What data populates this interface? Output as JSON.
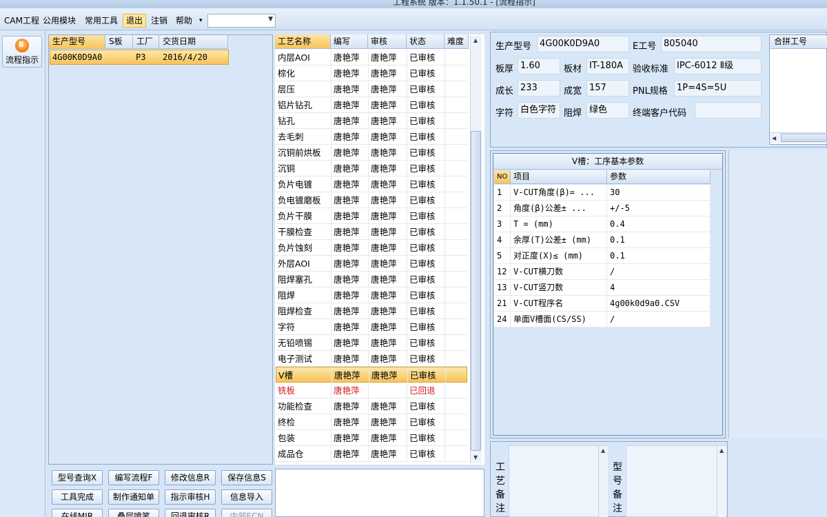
{
  "window": {
    "title": "工程系统   版本：1.1.50.1 - [流程指示]"
  },
  "menu": {
    "items": [
      "CAM工程",
      "公用模块",
      "常用工具",
      "退出",
      "注销",
      "帮助"
    ],
    "help_arrow": "▾",
    "combo_value": ""
  },
  "toolbar": {
    "flow_button": "流程指示"
  },
  "model_list": {
    "columns": [
      "生产型号",
      "S板",
      "工厂",
      "交货日期"
    ],
    "rows": [
      {
        "model": "4G00K0D9A0",
        "s": "",
        "factory": "P3",
        "date": "2016/4/20"
      }
    ]
  },
  "process_list": {
    "columns": [
      "工艺名称",
      "编写",
      "审核",
      "状态",
      "难度"
    ],
    "rows": [
      {
        "name": "内层AOI",
        "writer": "唐艳萍",
        "reviewer": "唐艳萍",
        "status": "已审核"
      },
      {
        "name": "棕化",
        "writer": "唐艳萍",
        "reviewer": "唐艳萍",
        "status": "已审核"
      },
      {
        "name": "层压",
        "writer": "唐艳萍",
        "reviewer": "唐艳萍",
        "status": "已审核"
      },
      {
        "name": "铝片钻孔",
        "writer": "唐艳萍",
        "reviewer": "唐艳萍",
        "status": "已审核"
      },
      {
        "name": "钻孔",
        "writer": "唐艳萍",
        "reviewer": "唐艳萍",
        "status": "已审核"
      },
      {
        "name": "去毛刺",
        "writer": "唐艳萍",
        "reviewer": "唐艳萍",
        "status": "已审核"
      },
      {
        "name": "沉铜前烘板",
        "writer": "唐艳萍",
        "reviewer": "唐艳萍",
        "status": "已审核"
      },
      {
        "name": "沉铜",
        "writer": "唐艳萍",
        "reviewer": "唐艳萍",
        "status": "已审核"
      },
      {
        "name": "负片电镀",
        "writer": "唐艳萍",
        "reviewer": "唐艳萍",
        "status": "已审核"
      },
      {
        "name": "负电镀磨板",
        "writer": "唐艳萍",
        "reviewer": "唐艳萍",
        "status": "已审核"
      },
      {
        "name": "负片干膜",
        "writer": "唐艳萍",
        "reviewer": "唐艳萍",
        "status": "已审核"
      },
      {
        "name": "干膜检查",
        "writer": "唐艳萍",
        "reviewer": "唐艳萍",
        "status": "已审核"
      },
      {
        "name": "负片蚀刻",
        "writer": "唐艳萍",
        "reviewer": "唐艳萍",
        "status": "已审核"
      },
      {
        "name": "外层AOI",
        "writer": "唐艳萍",
        "reviewer": "唐艳萍",
        "status": "已审核"
      },
      {
        "name": "阻焊塞孔",
        "writer": "唐艳萍",
        "reviewer": "唐艳萍",
        "status": "已审核"
      },
      {
        "name": "阻焊",
        "writer": "唐艳萍",
        "reviewer": "唐艳萍",
        "status": "已审核"
      },
      {
        "name": "阻焊检查",
        "writer": "唐艳萍",
        "reviewer": "唐艳萍",
        "status": "已审核"
      },
      {
        "name": "字符",
        "writer": "唐艳萍",
        "reviewer": "唐艳萍",
        "status": "已审核"
      },
      {
        "name": "无铅喷锡",
        "writer": "唐艳萍",
        "reviewer": "唐艳萍",
        "status": "已审核"
      },
      {
        "name": "电子测试",
        "writer": "唐艳萍",
        "reviewer": "唐艳萍",
        "status": "已审核"
      },
      {
        "name": "V槽",
        "writer": "唐艳萍",
        "reviewer": "唐艳萍",
        "status": "已审核",
        "selected": true
      },
      {
        "name": "铣板",
        "writer": "唐艳萍",
        "reviewer": "",
        "status": "已回退",
        "rejected": true
      },
      {
        "name": "功能检查",
        "writer": "唐艳萍",
        "reviewer": "唐艳萍",
        "status": "已审核"
      },
      {
        "name": "终检",
        "writer": "唐艳萍",
        "reviewer": "唐艳萍",
        "status": "已审核"
      },
      {
        "name": "包装",
        "writer": "唐艳萍",
        "reviewer": "唐艳萍",
        "status": "已审核"
      },
      {
        "name": "成品仓",
        "writer": "唐艳萍",
        "reviewer": "唐艳萍",
        "status": "已审核"
      }
    ]
  },
  "actions": {
    "row1": [
      "型号查询X",
      "编写流程F",
      "修改信息R",
      "保存信息S"
    ],
    "row2": [
      "工具完成",
      "制作通知单",
      "指示审核H",
      "信息导入"
    ],
    "row3": [
      "在线MIR",
      "叠层喷笔",
      "回退审核R",
      "内部ECN"
    ]
  },
  "info": {
    "model_label": "生产型号",
    "model_value": "4G00K0D9A0",
    "eng_label": "E工号",
    "eng_value": "805040",
    "thickness_label": "板厚",
    "thickness_value": "1.60",
    "material_label": "板材",
    "material_value": "IT-180A",
    "standard_label": "验收标准",
    "standard_value": "IPC-6012 Ⅱ级",
    "length_label": "成长",
    "length_value": "233",
    "width_label": "成宽",
    "width_value": "157",
    "pnl_label": "PNL规格",
    "pnl_value": "1P=4S=5U",
    "char_label": "字符",
    "char_value": "白色字符",
    "mask_label": "阻焊",
    "mask_value": "绿色",
    "customer_label": "终端客户代码",
    "customer_value": "",
    "merge_label": "合拼工号"
  },
  "params": {
    "title": "V槽：工序基本参数",
    "columns": [
      "NO",
      "项目",
      "参数"
    ],
    "rows": [
      {
        "no": "1",
        "item": "V-CUT角度(β)=  ...",
        "value": "30"
      },
      {
        "no": "2",
        "item": "角度(β)公差±  ...",
        "value": "+/-5"
      },
      {
        "no": "3",
        "item": "T = (mm)",
        "value": "0.4"
      },
      {
        "no": "4",
        "item": "余厚(T)公差± (mm)",
        "value": "0.1"
      },
      {
        "no": "5",
        "item": "对正度(X)≤ (mm)",
        "value": "0.1"
      },
      {
        "no": "12",
        "item": "V-CUT横刀数",
        "value": "/"
      },
      {
        "no": "13",
        "item": "V-CUT竖刀数",
        "value": "4"
      },
      {
        "no": "21",
        "item": "V-CUT程序名",
        "value": "4g00k0d9a0.CSV"
      },
      {
        "no": "24",
        "item": "单面V槽面(CS/SS)",
        "value": "/"
      }
    ]
  },
  "remarks": {
    "process_label": [
      "工",
      "艺",
      "备",
      "注"
    ],
    "model_label": [
      "型",
      "号",
      "备",
      "注"
    ]
  }
}
